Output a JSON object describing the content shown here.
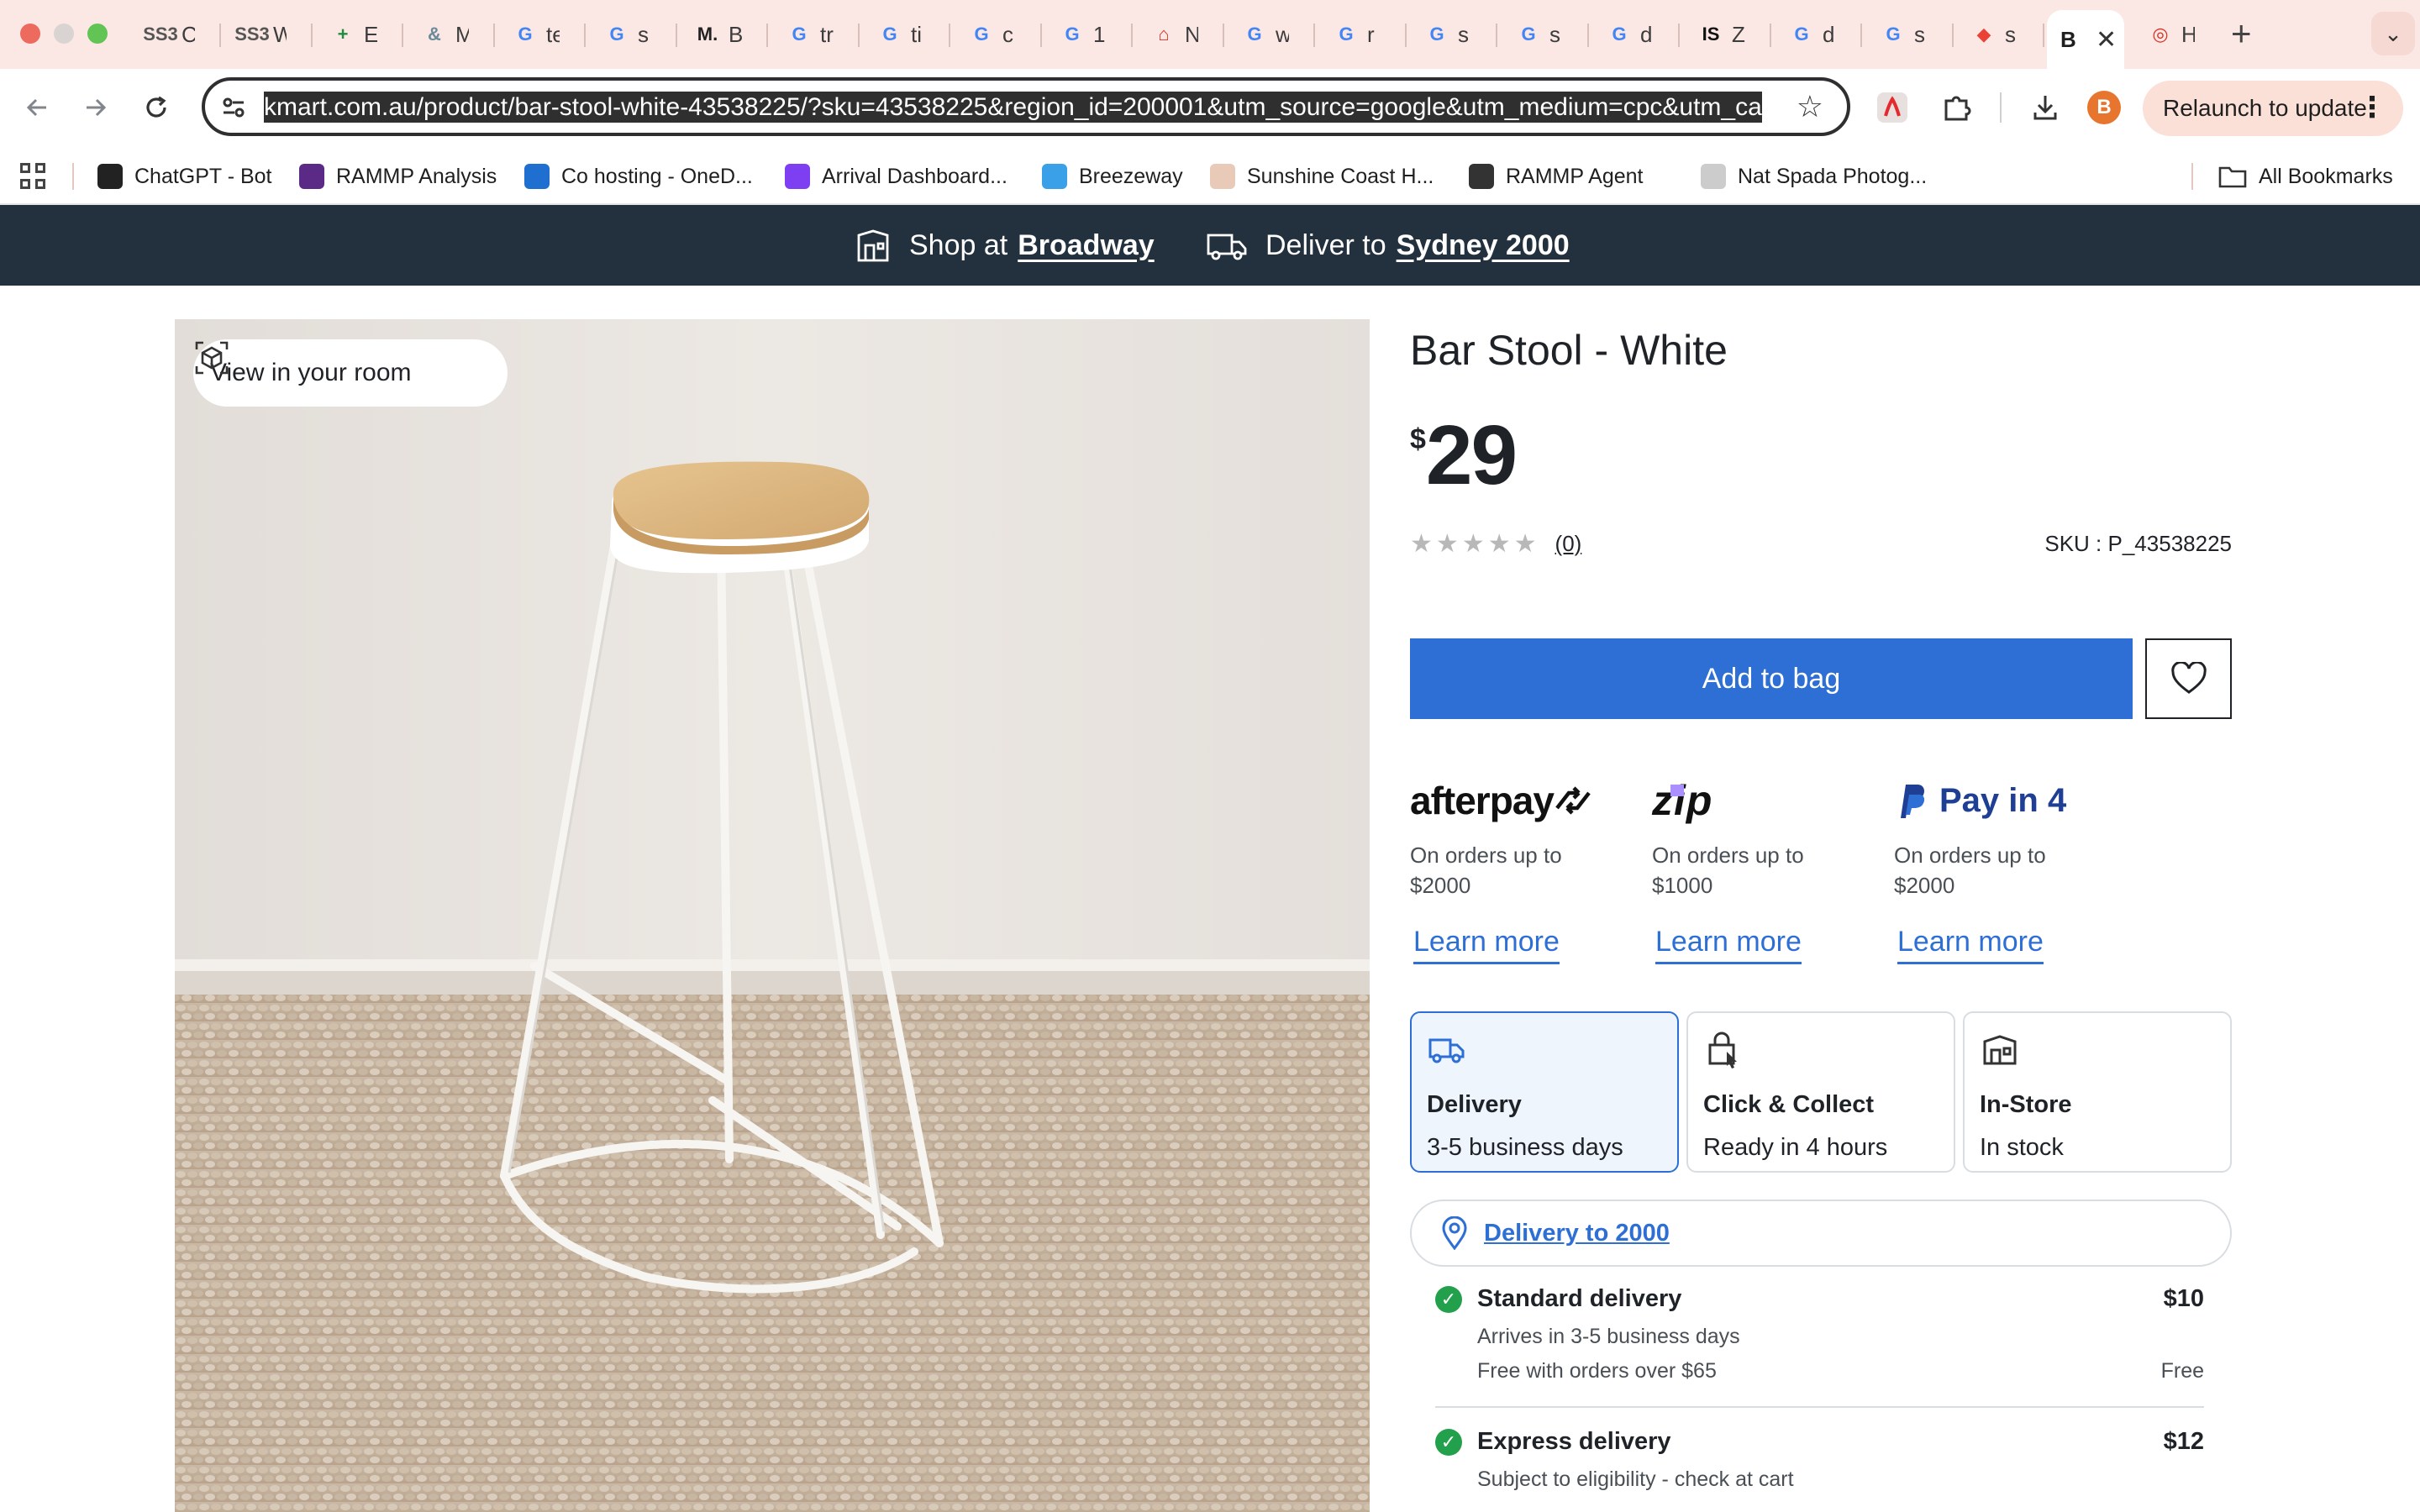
{
  "browser": {
    "tabs": [
      {
        "favicon": "SS3",
        "title": "C",
        "color": "#555555"
      },
      {
        "favicon": "SS3",
        "title": "W",
        "color": "#555555"
      },
      {
        "favicon": "+",
        "title": "E",
        "color": "#1e8e3e"
      },
      {
        "favicon": "&",
        "title": "M",
        "color": "#6b8a9a"
      },
      {
        "favicon": "G",
        "title": "te",
        "color": "#4285f4"
      },
      {
        "favicon": "G",
        "title": "s",
        "color": "#4285f4"
      },
      {
        "favicon": "M.",
        "title": "B",
        "color": "#222222"
      },
      {
        "favicon": "G",
        "title": "tr",
        "color": "#4285f4"
      },
      {
        "favicon": "G",
        "title": "ti",
        "color": "#4285f4"
      },
      {
        "favicon": "G",
        "title": "c",
        "color": "#4285f4"
      },
      {
        "favicon": "G",
        "title": "1",
        "color": "#4285f4"
      },
      {
        "favicon": "⌂",
        "title": "N",
        "color": "#d93025"
      },
      {
        "favicon": "G",
        "title": "w",
        "color": "#4285f4"
      },
      {
        "favicon": "G",
        "title": "r",
        "color": "#4285f4"
      },
      {
        "favicon": "G",
        "title": "s",
        "color": "#4285f4"
      },
      {
        "favicon": "G",
        "title": "s",
        "color": "#4285f4"
      },
      {
        "favicon": "G",
        "title": "d",
        "color": "#4285f4"
      },
      {
        "favicon": "IS",
        "title": "Z",
        "color": "#111111"
      },
      {
        "favicon": "G",
        "title": "d",
        "color": "#4285f4"
      },
      {
        "favicon": "G",
        "title": "s",
        "color": "#4285f4"
      },
      {
        "favicon": "◆",
        "title": "s",
        "color": "#ea4335"
      }
    ],
    "active_tab": {
      "title": "B"
    },
    "trailing_tab": {
      "favicon": "◎",
      "title": "H",
      "color": "#d93025"
    },
    "url": "kmart.com.au/product/bar-stool-white-43538225/?sku=43538225&region_id=200001&utm_source=google&utm_medium=cpc&utm_ca",
    "relaunch_label": "Relaunch to update",
    "profile_initial": "B",
    "bookmarks": [
      {
        "label": "ChatGPT - Bot",
        "icon": "openai-icon",
        "color": "#222222"
      },
      {
        "label": "RAMMP Analysis",
        "icon": "chart-icon",
        "color": "#5b2a86"
      },
      {
        "label": "Co hosting - OneD...",
        "icon": "cloud-icon",
        "color": "#1f6fd1"
      },
      {
        "label": "Arrival Dashboard...",
        "icon": "f-icon",
        "color": "#7e3ff2"
      },
      {
        "label": "Breezeway",
        "icon": "b-icon",
        "color": "#3aa0e8"
      },
      {
        "label": "Sunshine Coast H...",
        "icon": "page-icon",
        "color": "#e9c9b8"
      },
      {
        "label": "RAMMP Agent",
        "icon": "globe-fire-icon",
        "color": "#333333"
      },
      {
        "label": "Nat Spada Photog...",
        "icon": "page-icon",
        "color": "#cccccc"
      }
    ],
    "all_bookmarks_label": "All Bookmarks"
  },
  "banner": {
    "shop_prefix": "Shop at",
    "shop_store": "Broadway",
    "deliver_prefix": "Deliver to",
    "deliver_location": "Sydney 2000"
  },
  "product": {
    "room_button": "View in your room",
    "title": "Bar Stool - White",
    "currency": "$",
    "price": "29",
    "rating_stars": 0,
    "review_count": "(0)",
    "sku": "SKU : P_43538225",
    "add_to_bag": "Add to bag"
  },
  "payments": [
    {
      "logo": "afterpay",
      "desc": "On orders up to $2000",
      "link": "Learn more"
    },
    {
      "logo": "zip",
      "desc": "On orders up to $1000",
      "link": "Learn more"
    },
    {
      "logo": "Pay in 4",
      "desc": "On orders up to $2000",
      "link": "Learn more"
    }
  ],
  "fulfilment": [
    {
      "title": "Delivery",
      "subtitle": "3-5 business days",
      "icon": "truck-icon",
      "selected": true
    },
    {
      "title": "Click & Collect",
      "subtitle": "Ready in 4 hours",
      "icon": "bag-cursor-icon",
      "selected": false
    },
    {
      "title": "In-Store",
      "subtitle": "In stock",
      "icon": "store-icon",
      "selected": false
    }
  ],
  "location_link": "Delivery to 2000",
  "delivery_options": [
    {
      "name": "Standard delivery",
      "cost": "$10",
      "lines": [
        [
          "Arrives in 3-5 business days",
          ""
        ],
        [
          "Free with orders over $65",
          "Free"
        ]
      ]
    },
    {
      "name": "Express delivery",
      "cost": "$12",
      "lines": [
        [
          "Subject to eligibility - check at cart",
          ""
        ]
      ]
    }
  ],
  "colors": {
    "brand_dark": "#23313e",
    "accent_blue": "#2d6fd4",
    "success_green": "#23a04b"
  }
}
